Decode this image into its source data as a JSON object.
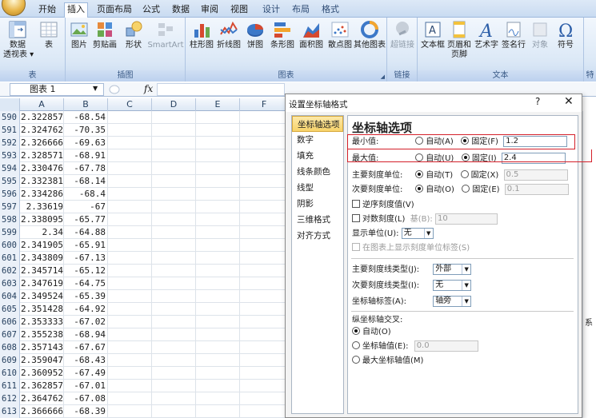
{
  "ribbon_tabs": [
    {
      "label": "开始"
    },
    {
      "label": "插入"
    },
    {
      "label": "页面布局"
    },
    {
      "label": "公式"
    },
    {
      "label": "数据"
    },
    {
      "label": "审阅"
    },
    {
      "label": "视图"
    },
    {
      "label": "设计"
    },
    {
      "label": "布局"
    },
    {
      "label": "格式"
    }
  ],
  "ribbon": {
    "table_group": {
      "label": "表",
      "pivot": "数据\n透视表 ▾",
      "table": "表"
    },
    "illustrations_group": {
      "label": "插图",
      "picture": "图片",
      "clipart": "剪贴画",
      "shapes": "形状",
      "smartart": "SmartArt"
    },
    "charts_group": {
      "label": "图表",
      "column": "柱形图",
      "line": "折线图",
      "pie": "饼图",
      "bar": "条形图",
      "area": "面积图",
      "scatter": "散点图",
      "other": "其他图表"
    },
    "links_group": {
      "label": "链接",
      "hyperlink": "超链接"
    },
    "text_group": {
      "label": "文本",
      "textbox": "文本框",
      "header_footer": "页眉和\n页脚",
      "wordart": "艺术字",
      "signature": "签名行",
      "object": "对象",
      "symbol": "符号"
    },
    "special_group": {
      "label": "特"
    }
  },
  "formula_bar": {
    "name_box": "图表 1",
    "fx": "fx"
  },
  "columns": [
    "A",
    "B",
    "C",
    "D",
    "E",
    "F"
  ],
  "rows": [
    {
      "num": "590",
      "a": "2.322857",
      "b": "-68.54"
    },
    {
      "num": "591",
      "a": "2.324762",
      "b": "-70.35"
    },
    {
      "num": "592",
      "a": "2.326666",
      "b": "-69.63"
    },
    {
      "num": "593",
      "a": "2.328571",
      "b": "-68.91"
    },
    {
      "num": "594",
      "a": "2.330476",
      "b": "-67.78"
    },
    {
      "num": "595",
      "a": "2.332381",
      "b": "-68.14"
    },
    {
      "num": "596",
      "a": "2.334286",
      "b": "-68.4"
    },
    {
      "num": "597",
      "a": "2.33619",
      "b": "-67"
    },
    {
      "num": "598",
      "a": "2.338095",
      "b": "-65.77"
    },
    {
      "num": "599",
      "a": "2.34",
      "b": "-64.88"
    },
    {
      "num": "600",
      "a": "2.341905",
      "b": "-65.91"
    },
    {
      "num": "601",
      "a": "2.343809",
      "b": "-67.13"
    },
    {
      "num": "602",
      "a": "2.345714",
      "b": "-65.12"
    },
    {
      "num": "603",
      "a": "2.347619",
      "b": "-64.75"
    },
    {
      "num": "604",
      "a": "2.349524",
      "b": "-65.39"
    },
    {
      "num": "605",
      "a": "2.351428",
      "b": "-64.92"
    },
    {
      "num": "606",
      "a": "2.353333",
      "b": "-67.02"
    },
    {
      "num": "607",
      "a": "2.355238",
      "b": "-68.94"
    },
    {
      "num": "608",
      "a": "2.357143",
      "b": "-67.67"
    },
    {
      "num": "609",
      "a": "2.359047",
      "b": "-68.43"
    },
    {
      "num": "610",
      "a": "2.360952",
      "b": "-67.49"
    },
    {
      "num": "611",
      "a": "2.362857",
      "b": "-67.01"
    },
    {
      "num": "612",
      "a": "2.364762",
      "b": "-67.08"
    },
    {
      "num": "613",
      "a": "2.366666",
      "b": "-68.39"
    }
  ],
  "sheet_edge_text": "系",
  "dialog": {
    "title": "设置坐标轴格式",
    "help": "?",
    "close": "✕",
    "nav": [
      "坐标轴选项",
      "数字",
      "填充",
      "线条颜色",
      "线型",
      "阴影",
      "三维格式",
      "对齐方式"
    ],
    "heading": "坐标轴选项",
    "min": {
      "label": "最小值:",
      "auto": "自动(A)",
      "fixed": "固定(F)",
      "value": "1.2"
    },
    "max": {
      "label": "最大值:",
      "auto": "自动(U)",
      "fixed": "固定(I)",
      "value": "2.4"
    },
    "major_unit": {
      "label": "主要刻度单位:",
      "auto": "自动(T)",
      "fixed": "固定(X)",
      "value": "0.5"
    },
    "minor_unit": {
      "label": "次要刻度单位:",
      "auto": "自动(O)",
      "fixed": "固定(E)",
      "value": "0.1"
    },
    "reverse": "逆序刻度值(V)",
    "log": {
      "label": "对数刻度(L)",
      "base_label": "基(B):",
      "base_value": "10"
    },
    "display_units": {
      "label": "显示单位(U):",
      "value": "无"
    },
    "show_units_label": "在图表上显示刻度单位标签(S)",
    "major_tick": {
      "label": "主要刻度线类型(J):",
      "value": "外部"
    },
    "minor_tick": {
      "label": "次要刻度线类型(I):",
      "value": "无"
    },
    "axis_labels": {
      "label": "坐标轴标签(A):",
      "value": "轴旁"
    },
    "cross": {
      "label": "纵坐标轴交叉:",
      "auto": "自动(O)",
      "value_label": "坐标轴值(E):",
      "value": "0.0",
      "max_label": "最大坐标轴值(M)"
    }
  },
  "colors": {
    "highlight": "#d4202a",
    "ribbon_bg": "#dbe8f6",
    "selected_nav": "#f7d36a"
  }
}
